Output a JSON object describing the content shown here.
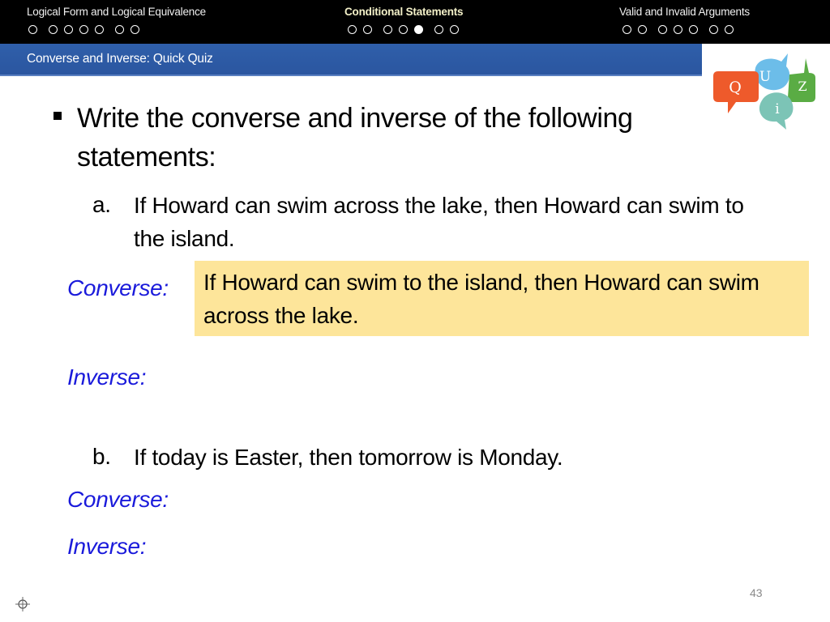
{
  "nav": {
    "sections": [
      {
        "title": "Logical Form and Logical Equivalence",
        "dots": 7,
        "active_dot": null,
        "active": false
      },
      {
        "title": "Conditional Statements",
        "dots": 7,
        "active_dot": 5,
        "active": true
      },
      {
        "title": "Valid and Invalid Arguments",
        "dots": 7,
        "active_dot": null,
        "active": false
      }
    ]
  },
  "subheader": {
    "title": "Converse and Inverse: Quick Quiz"
  },
  "logo": {
    "icon": "quiz-speech-bubbles-icon",
    "letters": [
      "Q",
      "U",
      "i",
      "Z"
    ],
    "colors": {
      "q": "#ee5a2b",
      "u": "#6cbde9",
      "i": "#7cc4b6",
      "z": "#5aac44"
    }
  },
  "content": {
    "instruction": "Write the converse and inverse of the following statements:",
    "items": [
      {
        "letter": "a.",
        "statement": "If Howard can swim across the lake, then Howard can swim to the island.",
        "converse_label": "Converse:",
        "converse_answer": "If Howard can swim to the island, then Howard can swim across the lake.",
        "inverse_label": "Inverse:"
      },
      {
        "letter": "b.",
        "statement": "If today is Easter, then tomorrow is Monday.",
        "converse_label": "Converse:",
        "inverse_label": "Inverse:"
      }
    ]
  },
  "colors": {
    "label_blue": "#1a1adb",
    "answer_highlight": "#fde59a",
    "subbar_blue": "#2d5aa5"
  },
  "footer": {
    "page_number": "43",
    "icon": "crosshair-icon"
  }
}
